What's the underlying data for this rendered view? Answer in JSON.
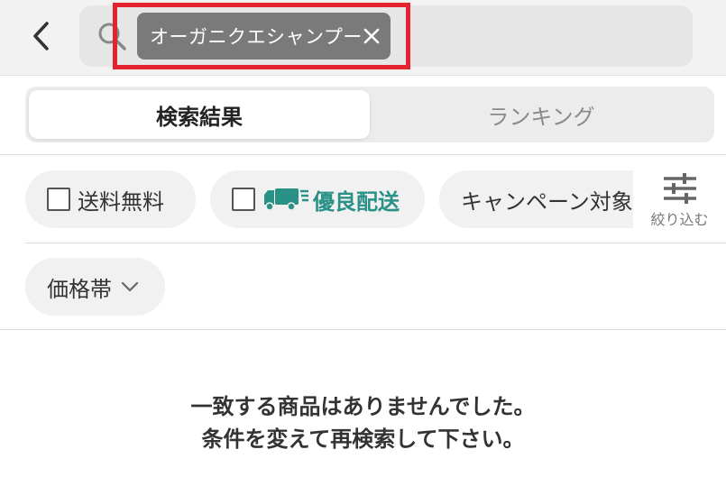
{
  "header": {
    "search_keyword": "オーガニクエシャンプー",
    "back_icon": "chevron-left-icon",
    "search_icon": "search-icon",
    "clear_icon": "close-icon",
    "highlight_color": "#e3232f"
  },
  "tabs": [
    {
      "label": "検索結果",
      "active": true
    },
    {
      "label": "ランキング",
      "active": false
    }
  ],
  "filters": {
    "free_shipping": "送料無料",
    "good_delivery": "優良配送",
    "good_delivery_color": "#2a9187",
    "campaign": "キャンペーン対象",
    "narrow_label": "絞り込む",
    "narrow_icon": "sliders-icon",
    "price_range": "価格帯"
  },
  "message": {
    "line1": "一致する商品はありませんでした。",
    "line2": "条件を変えて再検索して下さい。"
  }
}
